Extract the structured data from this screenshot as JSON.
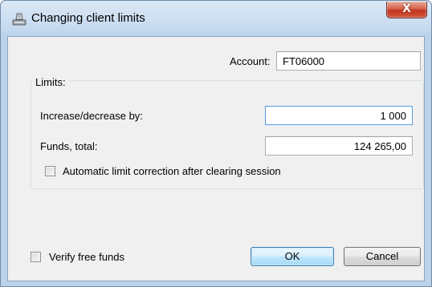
{
  "window": {
    "title": "Changing client limits",
    "close_glyph": "X",
    "title_icon": "client-limits-icon"
  },
  "account": {
    "label": "Account:",
    "value": "FT06000"
  },
  "limits": {
    "group_title": "Limits:",
    "increase_label": "Increase/decrease by:",
    "increase_value": "1 000",
    "funds_label": "Funds, total:",
    "funds_value": "124 265,00",
    "auto_correction_label": "Automatic limit correction after clearing session",
    "auto_correction_checked": false
  },
  "footer": {
    "verify_label": "Verify free funds",
    "verify_checked": false,
    "ok_label": "OK",
    "cancel_label": "Cancel"
  },
  "colors": {
    "frame": "#bcd3ec",
    "client_bg": "#f0f0f0",
    "close_button": "#c4351c",
    "focus_border": "#569de5",
    "default_button_border": "#3c7fb1"
  }
}
